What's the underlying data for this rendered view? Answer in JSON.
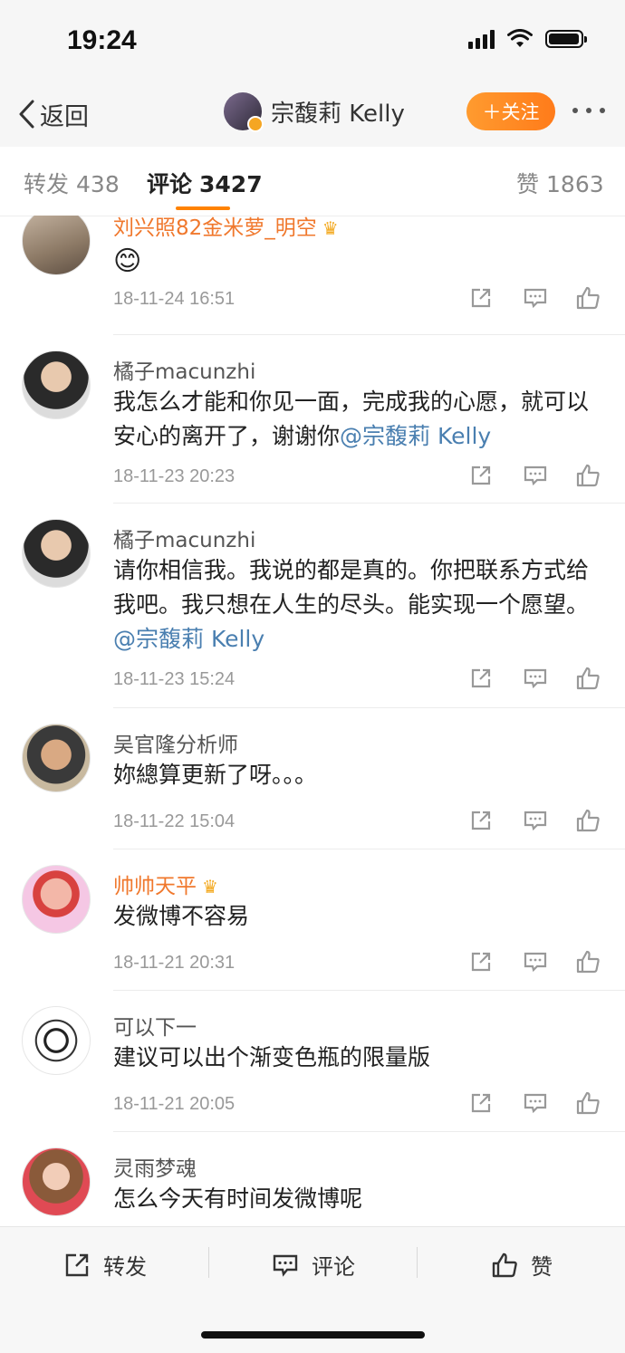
{
  "status": {
    "time": "19:24"
  },
  "nav": {
    "back_label": "返回",
    "user_name": "宗馥莉 Kelly",
    "follow_label": "＋关注"
  },
  "tabs": [
    {
      "label": "转发",
      "count": "438"
    },
    {
      "label": "评论",
      "count": "3427"
    },
    {
      "label": "赞",
      "count": "1863"
    }
  ],
  "comments": [
    {
      "user": "刘兴照82金米萝_明空",
      "vip": true,
      "text": "😊",
      "time": "18-11-24 16:51"
    },
    {
      "user": "橘子macunzhi",
      "vip": false,
      "text": "我怎么才能和你见一面，完成我的心愿，就可以安心的离开了，谢谢你",
      "mention": "@宗馥莉 Kelly",
      "time": "18-11-23 20:23"
    },
    {
      "user": "橘子macunzhi",
      "vip": false,
      "text": "请你相信我。我说的都是真的。你把联系方式给我吧。我只想在人生的尽头。能实现一个愿望。",
      "mention": "@宗馥莉 Kelly",
      "time": "18-11-23 15:24"
    },
    {
      "user": "吴官隆分析师",
      "vip": false,
      "text": "妳總算更新了呀。。。",
      "time": "18-11-22 15:04"
    },
    {
      "user": "帅帅天平",
      "vip": true,
      "text": "发微博不容易",
      "time": "18-11-21 20:31"
    },
    {
      "user": "可以下一",
      "vip": false,
      "text": "建议可以出个渐变色瓶的限量版",
      "time": "18-11-21 20:05"
    },
    {
      "user": "灵雨梦魂",
      "vip": false,
      "text": "怎么今天有时间发微博呢",
      "time": ""
    }
  ],
  "bottom": {
    "repost": "转发",
    "comment": "评论",
    "like": "赞"
  },
  "colors": {
    "accent": "#ff8200",
    "mention": "#4a7fb0",
    "vip_name": "#f0782d"
  }
}
